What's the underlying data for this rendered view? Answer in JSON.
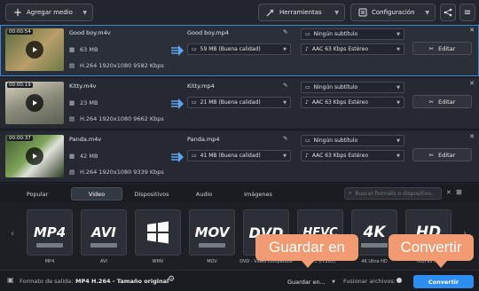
{
  "toolbar": {
    "add_media": "Agregar medio",
    "tools": "Herramientas",
    "settings": "Configuración"
  },
  "files": [
    {
      "duration": "00:00:54",
      "name": "Good boy.m4v",
      "size": "63 MB",
      "codec": "H.264 1920x1080 9582 Kbps",
      "output_name": "Good boy.mp4",
      "output_size": "59 MB (Buena calidad)",
      "subtitle": "Ningún subtítulo",
      "audio": "AAC 63 Kbps Estéreo",
      "edit": "Editar"
    },
    {
      "duration": "00:00:19",
      "name": "Kitty.m4v",
      "size": "23 MB",
      "codec": "H.264 1920x1080 9662 Kbps",
      "output_name": "Kitty.mp4",
      "output_size": "21 MB (Buena calidad)",
      "subtitle": "Ningún subtítulo",
      "audio": "AAC 63 Kbps Estéreo",
      "edit": "Editar"
    },
    {
      "duration": "00:00:37",
      "name": "Panda.m4v",
      "size": "42 MB",
      "codec": "H.264 1920x1080 9339 Kbps",
      "output_name": "Panda.mp4",
      "output_size": "41 MB (Buena calidad)",
      "subtitle": "Ningún subtítulo",
      "audio": "AAC 63 Kbps Estéreo",
      "edit": "Editar"
    }
  ],
  "tabs": [
    "Popular",
    "Video",
    "Dispositivos",
    "Audio",
    "Imágenes"
  ],
  "search": {
    "placeholder": "Buscar formato o dispositivo..."
  },
  "formats": [
    {
      "icon": "MP4",
      "label": "MP4"
    },
    {
      "icon": "AVI",
      "label": "AVI"
    },
    {
      "icon": "windows-logo-icon",
      "label": "WMV"
    },
    {
      "icon": "MOV",
      "label": "MOV"
    },
    {
      "icon": "DVD",
      "label": "DVD - Video compatible"
    },
    {
      "icon": "HEVC",
      "label": "HEVC (H.265)"
    },
    {
      "icon": "4K",
      "label": "4K Ultra HD"
    },
    {
      "icon": "HD",
      "label": "HD/Full HD"
    }
  ],
  "bottom": {
    "output_label": "Formato de salida:",
    "output_value": "MP4 H.264 - Tamaño original",
    "save_to": "Guardar en...",
    "merge": "Fusionar archivos:",
    "convert": "Convertir"
  },
  "callouts": {
    "save": "Guardar en",
    "convert": "Convertir"
  },
  "colors": {
    "accent": "#2d8df0",
    "callout": "#f29a72",
    "selected_outline": "#3b86d8"
  }
}
